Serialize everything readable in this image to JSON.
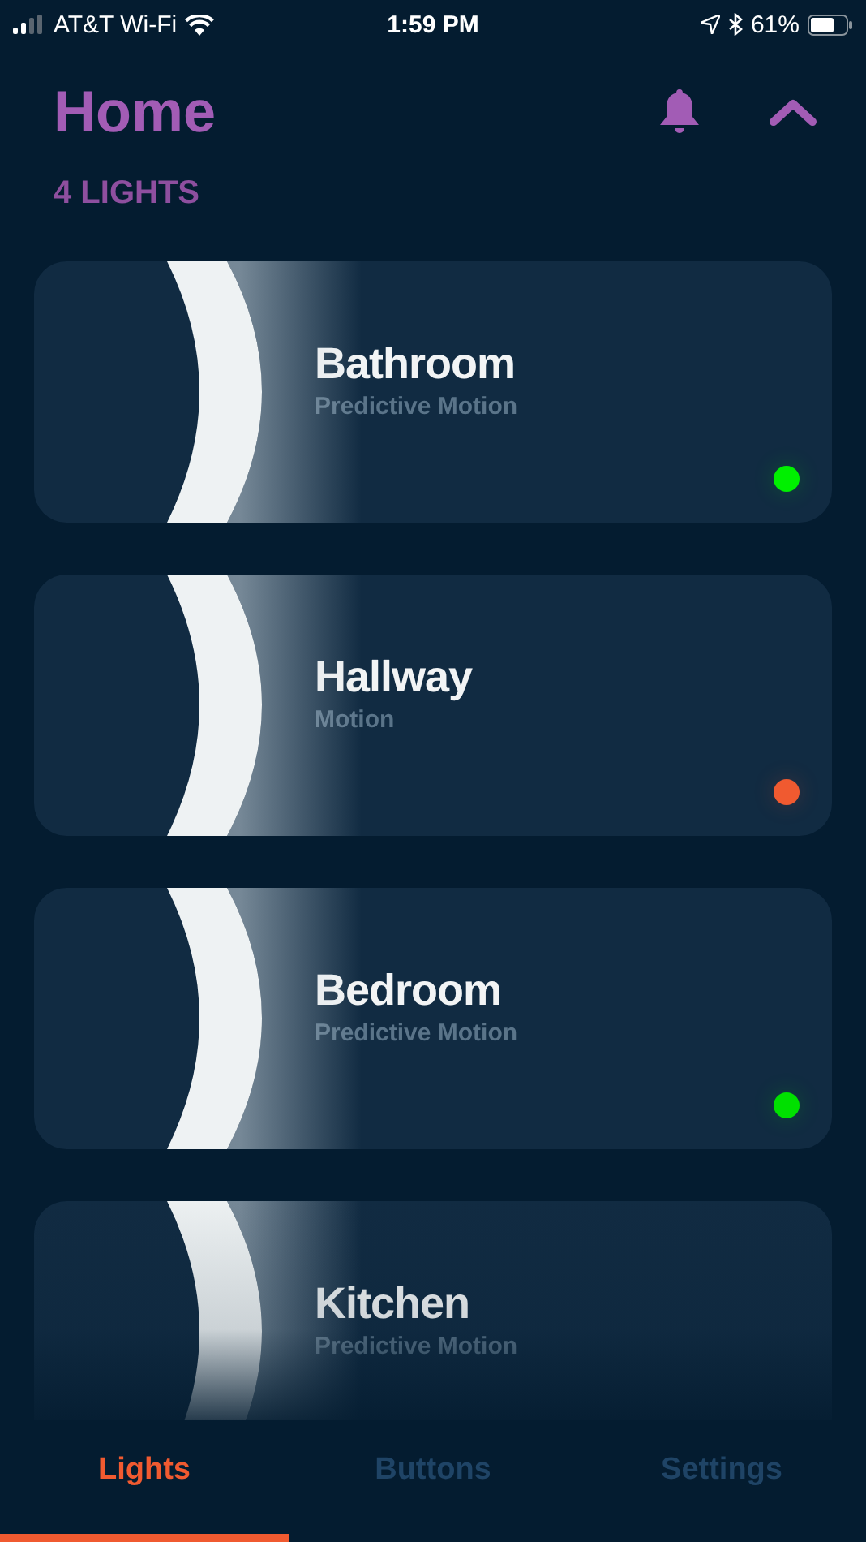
{
  "status_bar": {
    "carrier": "AT&T Wi-Fi",
    "time": "1:59 PM",
    "battery": "61%"
  },
  "header": {
    "title": "Home",
    "count": "4 LIGHTS"
  },
  "lights": [
    {
      "name": "Bathroom",
      "mode": "Predictive Motion",
      "color": "#00f000"
    },
    {
      "name": "Hallway",
      "mode": "Motion",
      "color": "#f05a30"
    },
    {
      "name": "Bedroom",
      "mode": "Predictive Motion",
      "color": "#00e000"
    },
    {
      "name": "Kitchen",
      "mode": "Predictive Motion"
    }
  ],
  "tabs": [
    {
      "label": "Lights",
      "selected": true
    },
    {
      "label": "Buttons",
      "selected": false
    },
    {
      "label": "Settings",
      "selected": false
    }
  ]
}
